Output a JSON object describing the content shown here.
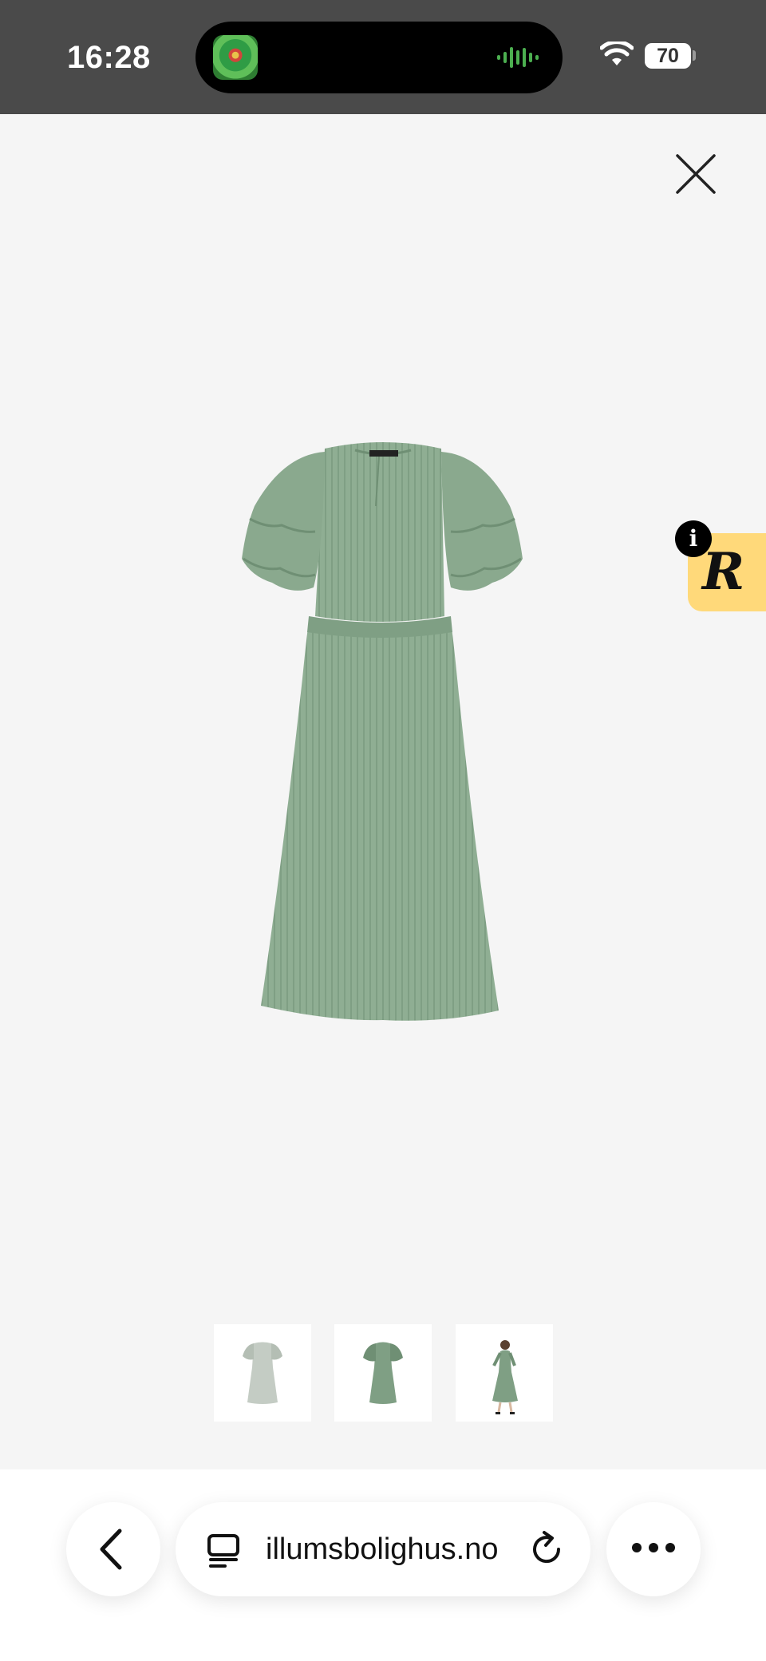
{
  "status_bar": {
    "time": "16:28",
    "battery": "70",
    "icons": [
      "app-thumbnail-icon",
      "audio-waveform-icon",
      "wifi-icon",
      "battery-icon"
    ]
  },
  "viewer": {
    "close_icon": "close-icon",
    "product_image": "green-dress-photo",
    "thumbnails": [
      {
        "name": "dress-back-view"
      },
      {
        "name": "dress-front-view"
      },
      {
        "name": "dress-model-view"
      }
    ]
  },
  "widget": {
    "letter": "R",
    "info_label": "i",
    "color": "#ffd97a"
  },
  "browser_bar": {
    "url": "illumsbolighus.no",
    "icons": [
      "back-icon",
      "tabs-icon",
      "reload-icon",
      "more-icon"
    ]
  },
  "colors": {
    "status_bar_bg": "#4a4a4a",
    "page_bg": "#f5f5f5",
    "dress_green": "#8fae93"
  }
}
